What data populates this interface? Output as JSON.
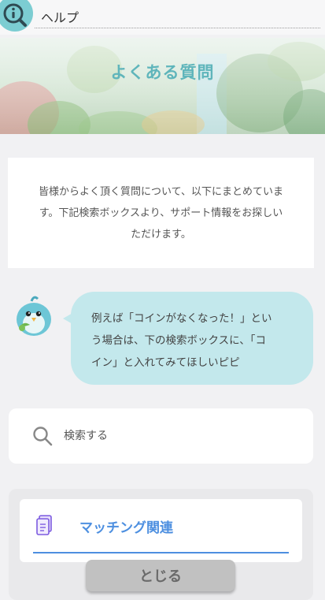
{
  "header": {
    "title": "ヘルプ",
    "icon": "info-icon",
    "accent": "#7ccdd2"
  },
  "banner": {
    "title": "よくある質問",
    "title_color": "#5fb5bb"
  },
  "intro": {
    "lines": [
      "皆様からよく頂く質問について、以下にまとめていま",
      "す。下記検索ボックスより、サポート情報をお探しい",
      "ただけます。"
    ]
  },
  "mascot": {
    "icon": "bird-mascot-icon",
    "bubble_lines": [
      "例えば「コインがなくなった！」とい",
      "う場合は、下の検索ボックスに、「コ",
      "イン」と入れてみてほしいピピ"
    ],
    "bubble_color": "#c3e8ec"
  },
  "search": {
    "placeholder": "検索する",
    "value": "",
    "icon": "search-icon"
  },
  "categories": [
    {
      "label": "マッチング関連",
      "icon": "document-icon",
      "color": "#4d8fe0"
    }
  ],
  "footer": {
    "close_label": "とじる"
  }
}
